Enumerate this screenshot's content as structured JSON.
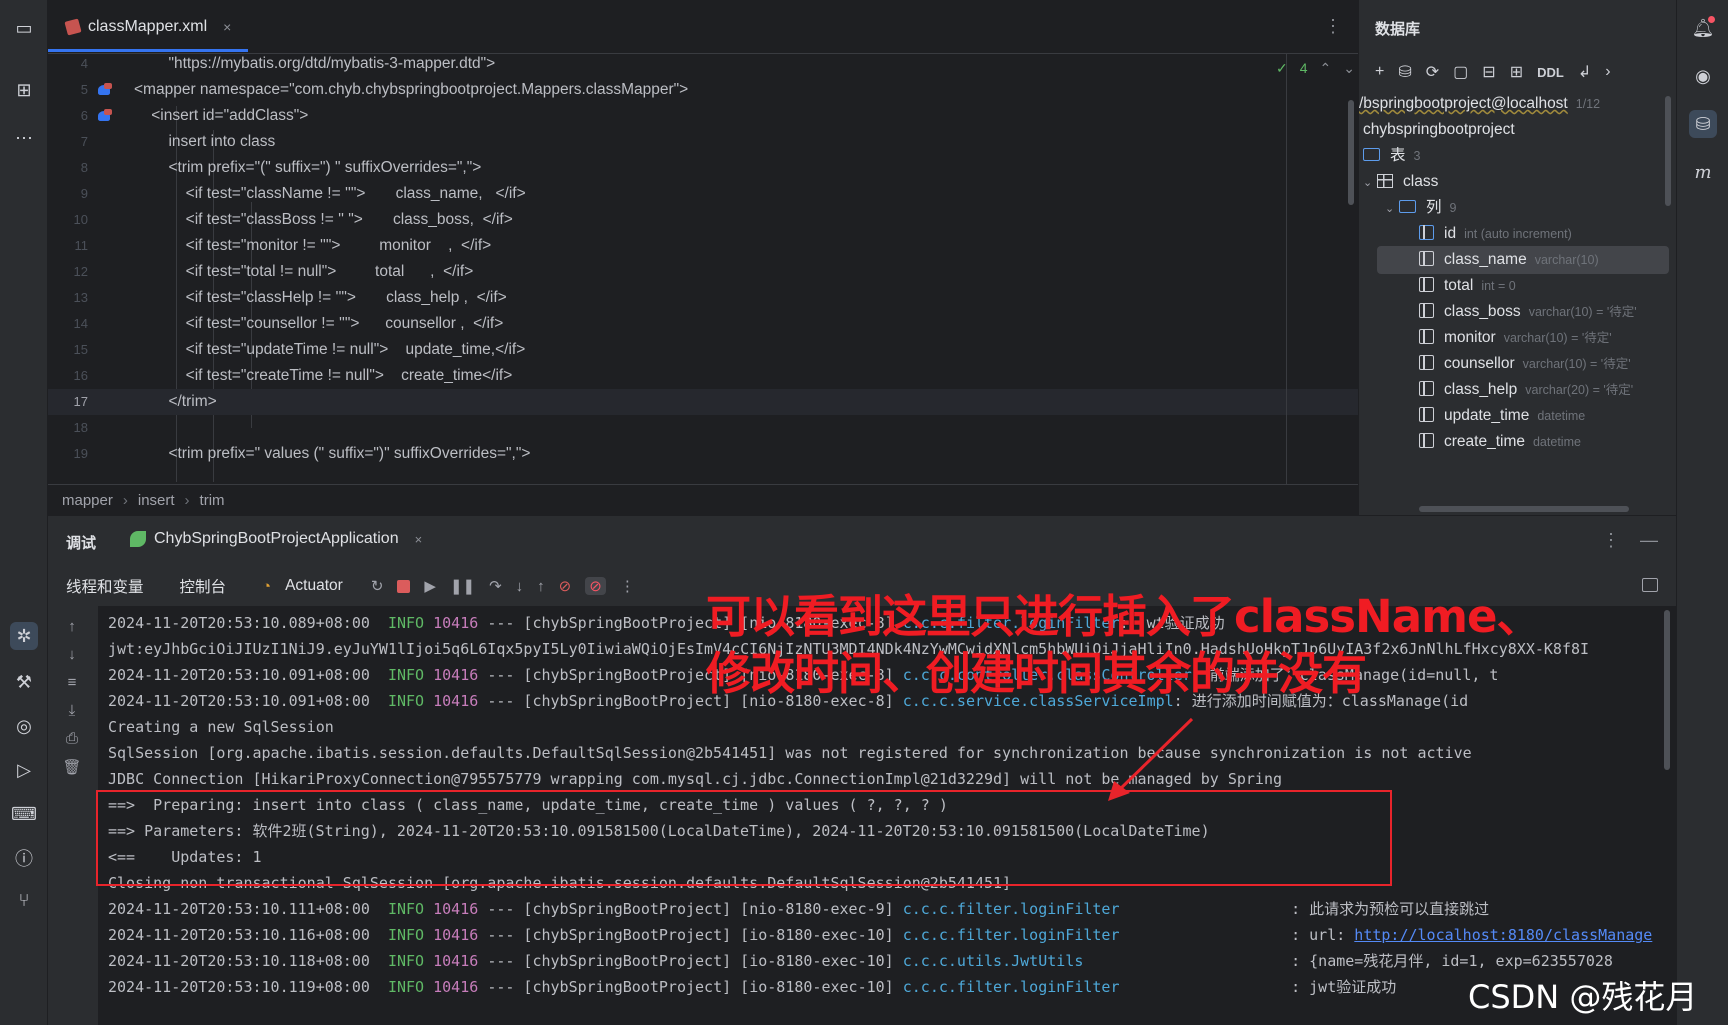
{
  "editor": {
    "tab_label": "classMapper.xml",
    "tab_close": "×",
    "inspection_count": "4",
    "breadcrumb": [
      "mapper",
      "insert",
      "trim"
    ],
    "lines": [
      {
        "no": "4",
        "text": "        \"https://mybatis.org/dtd/mybatis-3-mapper.dtd\">",
        "icon": false
      },
      {
        "no": "5",
        "text": "<mapper namespace=\"com.chyb.chybspringbootproject.Mappers.classMapper\">",
        "icon": true
      },
      {
        "no": "6",
        "text": "    <insert id=\"addClass\">",
        "icon": true
      },
      {
        "no": "7",
        "text": "        insert into class",
        "icon": false
      },
      {
        "no": "8",
        "text": "        <trim prefix=\"(\" suffix=\") \" suffixOverrides=\",\">",
        "icon": false
      },
      {
        "no": "9",
        "text": "            <if test=\"className != ''\">       class_name,   </if>",
        "icon": false
      },
      {
        "no": "10",
        "text": "            <if test=\"classBoss != '' \">       class_boss,  </if>",
        "icon": false
      },
      {
        "no": "11",
        "text": "            <if test=\"monitor != ''\">         monitor    ,  </if>",
        "icon": false
      },
      {
        "no": "12",
        "text": "            <if test=\"total != null\">         total      ,  </if>",
        "icon": false
      },
      {
        "no": "13",
        "text": "            <if test=\"classHelp != ''\">       class_help ,  </if>",
        "icon": false
      },
      {
        "no": "14",
        "text": "            <if test=\"counsellor != ''\">      counsellor ,  </if>",
        "icon": false
      },
      {
        "no": "15",
        "text": "            <if test=\"updateTime != null\">    update_time,</if>",
        "icon": false
      },
      {
        "no": "16",
        "text": "            <if test=\"createTime != null\">    create_time</if>",
        "icon": false
      },
      {
        "no": "17",
        "text": "        </trim>",
        "icon": false
      },
      {
        "no": "18",
        "text": "",
        "icon": false
      },
      {
        "no": "19",
        "text": "        <trim prefix=\" values (\" suffix=\")\" suffixOverrides=\",\">",
        "icon": false
      }
    ]
  },
  "db_panel": {
    "title": "数据库",
    "ddl_label": "DDL",
    "connection": "/bspringbootproject@localhost",
    "connection_count": "1/12",
    "schema": "chybspringbootproject",
    "tables_label": "表",
    "tables_count": "3",
    "table_name": "class",
    "columns_label": "列",
    "columns_count": "9",
    "columns": [
      {
        "name": "id",
        "type": "int (auto increment)"
      },
      {
        "name": "class_name",
        "type": "varchar(10)"
      },
      {
        "name": "total",
        "type": "int = 0"
      },
      {
        "name": "class_boss",
        "type": "varchar(10) = '待定'"
      },
      {
        "name": "monitor",
        "type": "varchar(10) = '待定'"
      },
      {
        "name": "counsellor",
        "type": "varchar(10) = '待定'"
      },
      {
        "name": "class_help",
        "type": "varchar(20) = '待定'"
      },
      {
        "name": "update_time",
        "type": "datetime"
      },
      {
        "name": "create_time",
        "type": "datetime"
      }
    ]
  },
  "debug": {
    "title": "调试",
    "run_config": "ChybSpringBootProjectApplication",
    "subtabs": [
      "线程和变量",
      "控制台"
    ],
    "actuator": "Actuator",
    "console_lines": [
      {
        "kind": "log",
        "time": "2024-11-20T20:53:10.089+08:00",
        "level": "INFO",
        "pid": "10416",
        "mid": "--- [chybSpringBootProject] [nio-8180-exec-8]",
        "logger": "c.c.c.filter.loginFilter",
        "msg": ": jwt验证成功"
      },
      {
        "kind": "plain",
        "text": "jwt:eyJhbGciOiJIUzI1NiJ9.eyJuYW1lIjoi5q6L6Iqx5pyI5Ly0IiwiaWQiOjEsImV4cCI6NjIzNTU3MDI4NDk4NzYwMCwidXNlcm5hbWUiOiJjaHliIn0.HadshUoHkpTJp6UyIA3f2x6JnNlhLfHxcy8XX-K8f8I"
      },
      {
        "kind": "log",
        "time": "2024-11-20T20:53:10.091+08:00",
        "level": "INFO",
        "pid": "10416",
        "mid": "--- [chybSpringBootProject] [nio-8180-exec-8]",
        "logger": "c.c.c.controller.classController",
        "msg": ": 前端添加了：classManage(id=null, t"
      },
      {
        "kind": "log",
        "time": "2024-11-20T20:53:10.091+08:00",
        "level": "INFO",
        "pid": "10416",
        "mid": "--- [chybSpringBootProject] [nio-8180-exec-8]",
        "logger": "c.c.c.service.classServiceImpl",
        "msg": ": 进行添加时间赋值为：classManage(id"
      },
      {
        "kind": "plain",
        "text": "Creating a new SqlSession"
      },
      {
        "kind": "plain",
        "text": "SqlSession [org.apache.ibatis.session.defaults.DefaultSqlSession@2b541451] was not registered for synchronization because synchronization is not active"
      },
      {
        "kind": "plain",
        "text": "JDBC Connection [HikariProxyConnection@795575779 wrapping com.mysql.cj.jdbc.ConnectionImpl@21d3229d] will not be managed by Spring"
      },
      {
        "kind": "plain",
        "text": "==>  Preparing: insert into class ( class_name, update_time, create_time ) values ( ?, ?, ? )"
      },
      {
        "kind": "plain",
        "text": "==> Parameters: 软件2班(String), 2024-11-20T20:53:10.091581500(LocalDateTime), 2024-11-20T20:53:10.091581500(LocalDateTime)"
      },
      {
        "kind": "plain",
        "text": "<==    Updates: 1"
      },
      {
        "kind": "plain",
        "text": "Closing non transactional SqlSession [org.apache.ibatis.session.defaults.DefaultSqlSession@2b541451]"
      },
      {
        "kind": "log",
        "time": "2024-11-20T20:53:10.111+08:00",
        "level": "INFO",
        "pid": "10416",
        "mid": "--- [chybSpringBootProject] [nio-8180-exec-9]",
        "logger": "c.c.c.filter.loginFilter",
        "msg": "                   : 此请求为预检可以直接跳过"
      },
      {
        "kind": "log",
        "time": "2024-11-20T20:53:10.116+08:00",
        "level": "INFO",
        "pid": "10416",
        "mid": "--- [chybSpringBootProject] [io-8180-exec-10]",
        "logger": "c.c.c.filter.loginFilter",
        "msg": "                   : url: ",
        "link": "http://localhost:8180/classManage"
      },
      {
        "kind": "log",
        "time": "2024-11-20T20:53:10.118+08:00",
        "level": "INFO",
        "pid": "10416",
        "mid": "--- [chybSpringBootProject] [io-8180-exec-10]",
        "logger": "c.c.c.utils.JwtUtils",
        "msg": "                       : {name=残花月伴, id=1, exp=623557028"
      },
      {
        "kind": "log",
        "time": "2024-11-20T20:53:10.119+08:00",
        "level": "INFO",
        "pid": "10416",
        "mid": "--- [chybSpringBootProject] [io-8180-exec-10]",
        "logger": "c.c.c.filter.loginFilter",
        "msg": "                   : jwt验证成功"
      }
    ]
  },
  "annotation": {
    "line1": "可以看到这里只进行插入了className、",
    "line2": "修改时间、创建时间其余的并没有"
  },
  "watermark": "CSDN @残花月伴",
  "colors": {
    "accent": "#3574f0",
    "annotation_red": "#e8242b",
    "info_green": "#5fb865"
  }
}
